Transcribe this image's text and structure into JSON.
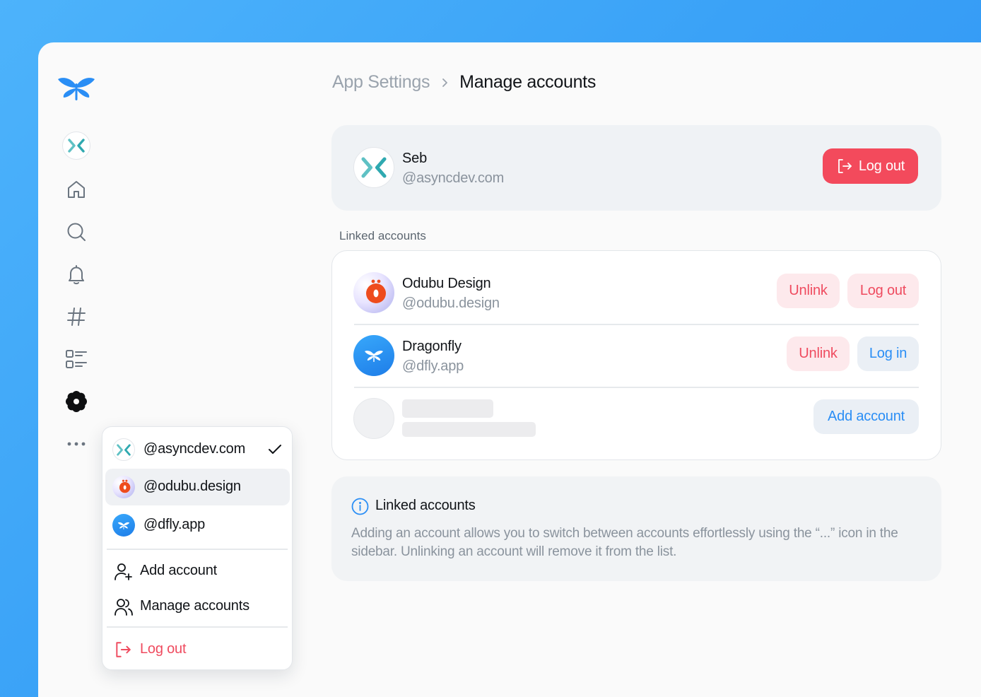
{
  "colors": {
    "brand_blue": "#2a8ef5",
    "danger": "#f34a5c",
    "teal": "#5fc1c4"
  },
  "sidebar": {
    "items": [
      {
        "icon": "dragonfly-logo-icon"
      },
      {
        "icon": "account-avatar-icon"
      },
      {
        "icon": "home-icon"
      },
      {
        "icon": "search-icon"
      },
      {
        "icon": "bell-icon"
      },
      {
        "icon": "hashtag-icon"
      },
      {
        "icon": "list-icon"
      },
      {
        "icon": "gear-icon",
        "active": true
      },
      {
        "icon": "more-icon"
      }
    ]
  },
  "breadcrumb": {
    "parent": "App Settings",
    "current": "Manage accounts"
  },
  "primary_account": {
    "name": "Seb",
    "handle": "@asyncdev.com",
    "logout_label": "Log out"
  },
  "linked_accounts": {
    "section_label": "Linked accounts",
    "items": [
      {
        "name": "Odubu Design",
        "handle": "@odubu.design",
        "unlink_label": "Unlink",
        "action_label": "Log out"
      },
      {
        "name": "Dragonfly",
        "handle": "@dfly.app",
        "unlink_label": "Unlink",
        "action_label": "Log in"
      }
    ],
    "add_label": "Add account"
  },
  "info": {
    "title": "Linked accounts",
    "body": "Adding an account allows you to switch between accounts effortlessly using the “...” icon in the sidebar. Unlinking an account will remove it from the list."
  },
  "menu": {
    "accounts": [
      {
        "handle": "@asyncdev.com",
        "checked": true
      },
      {
        "handle": "@odubu.design",
        "checked": false
      },
      {
        "handle": "@dfly.app",
        "checked": false
      }
    ],
    "add_account": "Add account",
    "manage_accounts": "Manage accounts",
    "logout": "Log out"
  }
}
